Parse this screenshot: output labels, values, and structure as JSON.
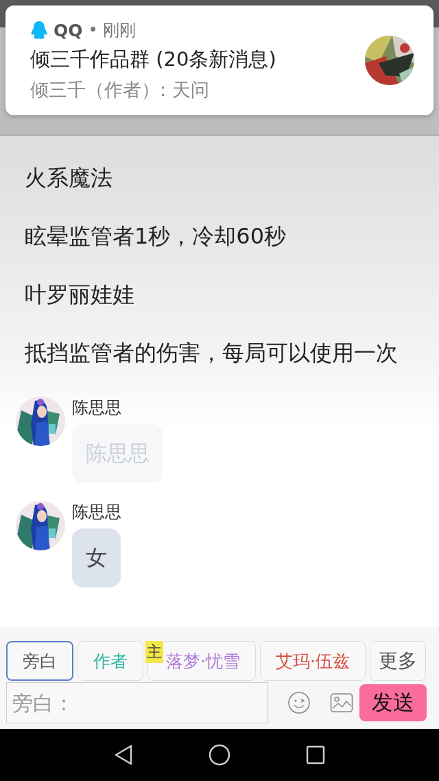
{
  "notification": {
    "app": "QQ",
    "time": "• 刚刚",
    "title": "倾三千作品群 (20条新消息)",
    "preview": "倾三千（作者）: 天问"
  },
  "story": [
    "火系魔法",
    "眩晕监管者1秒，冷却60秒",
    "叶罗丽娃娃",
    "抵挡监管者的伤害，每局可以使用一次"
  ],
  "messages": [
    {
      "sender": "陈思思",
      "text": "陈思思",
      "faded": true
    },
    {
      "sender": "陈思思",
      "text": "女",
      "faded": false
    }
  ],
  "roles": [
    {
      "label": "旁白",
      "color": "#555555",
      "selected": true
    },
    {
      "label": "作者",
      "color": "#2fb5a0",
      "selected": false
    },
    {
      "label": "落梦·忧雪",
      "color": "#b07ad8",
      "selected": false,
      "owner": "主"
    },
    {
      "label": "艾玛·伍兹",
      "color": "#d9443a",
      "selected": false
    }
  ],
  "more_button": "更多",
  "input": {
    "placeholder": "旁白："
  },
  "send_button": "发送"
}
